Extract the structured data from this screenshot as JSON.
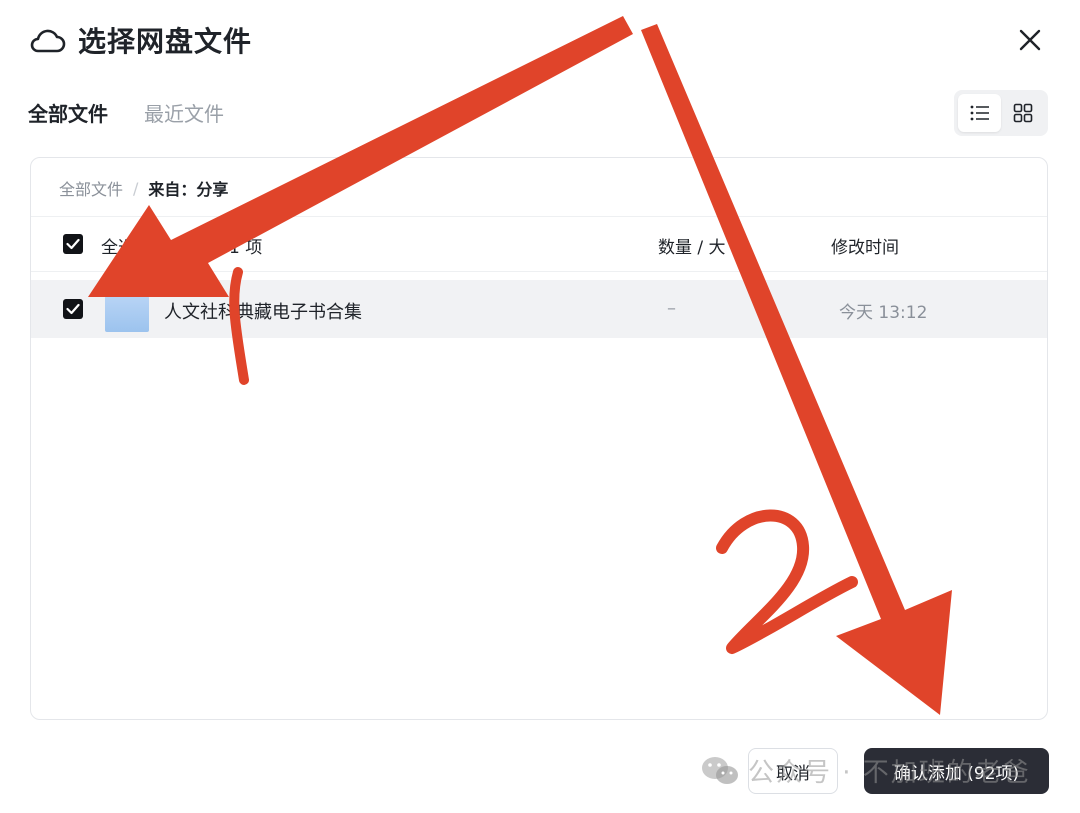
{
  "dialog": {
    "title": "选择网盘文件",
    "icons": {
      "title": "cloud-icon",
      "close": "close-icon"
    }
  },
  "tabs": [
    {
      "label": "全部文件",
      "active": true
    },
    {
      "label": "最近文件",
      "active": false
    }
  ],
  "view_toggle": {
    "list_icon": "list-view-icon",
    "grid_icon": "grid-view-icon",
    "selected": "list"
  },
  "breadcrumb": {
    "root": "全部文件",
    "current": "来自：分享"
  },
  "list_header": {
    "select_all": "全选",
    "name": "1 项",
    "count_size": "数量 / 大",
    "modified": "修改时间"
  },
  "rows": [
    {
      "name": "人文社科典藏电子书合集",
      "size": "–",
      "modified": "今天 13:12",
      "checked": true
    }
  ],
  "footer": {
    "cancel": "取消",
    "confirm": "确认添加 (92项)"
  },
  "watermark": {
    "text": "公众号 · 不加班的老爸"
  },
  "annotations": {
    "label_1": "1",
    "label_2": "2",
    "color": "#e0442a"
  },
  "colors": {
    "confirm_bg": "#2b2d36",
    "row_highlight": "#f1f2f4",
    "folder": "#a8ccf2"
  }
}
